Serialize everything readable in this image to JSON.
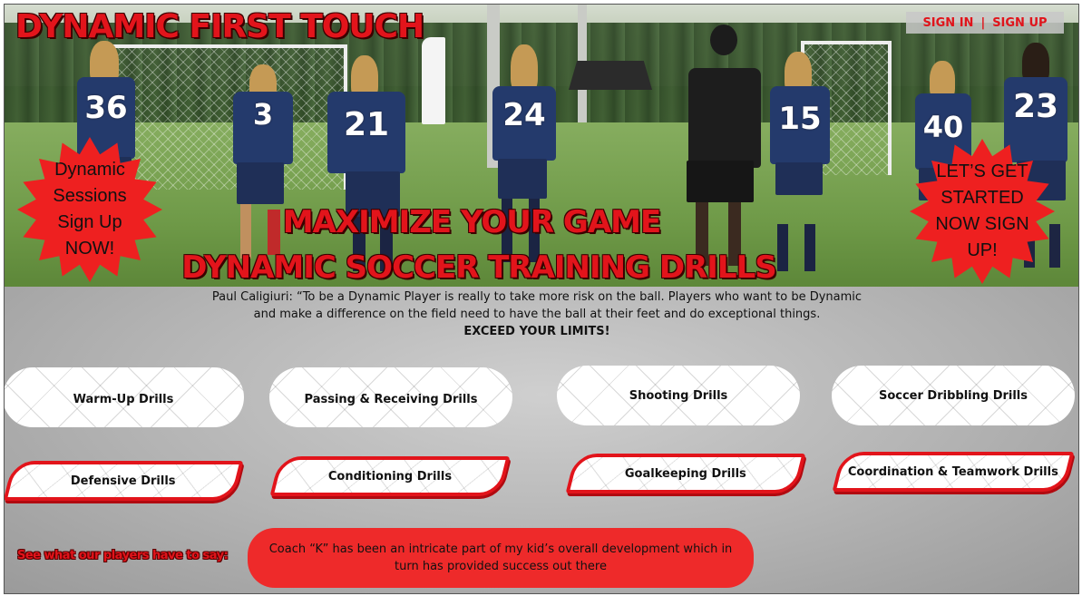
{
  "header": {
    "site_title": "DYNAMIC FIRST TOUCH",
    "sign_in": "SIGN IN",
    "separator": "|",
    "sign_up": "SIGN UP"
  },
  "hero": {
    "left_burst": "Dynamic Sessions Sign Up NOW!",
    "right_burst": "LET’S GET STARTED NOW SIGN UP!",
    "headline_line1": "MAXIMIZE YOUR GAME",
    "headline_line2": "DYNAMIC SOCCER TRAINING DRILLS",
    "jersey_numbers": [
      "36",
      "3",
      "21",
      "24",
      "15",
      "40",
      "23"
    ]
  },
  "quote": {
    "line1": "Paul Caligiuri: “To be a Dynamic Player is really to take more risk on the ball. Players who want to be Dynamic",
    "line2": "and make a difference on the field need to have the ball at their feet and do exceptional things.",
    "line3": "EXCEED YOUR LIMITS!"
  },
  "drills_row1": [
    {
      "label": "Warm-Up Drills"
    },
    {
      "label": "Passing & Receiving Drills"
    },
    {
      "label": "Shooting Drills"
    },
    {
      "label": "Soccer Dribbling Drills"
    }
  ],
  "drills_row2": [
    {
      "label": "Defensive Drills"
    },
    {
      "label": "Conditioning Drills"
    },
    {
      "label": "Goalkeeping Drills"
    },
    {
      "label": "Coordination & Teamwork Drills"
    }
  ],
  "testimonial": {
    "label": "See what our players have to say:",
    "text": "Coach “K” has been an intricate part of my kid’s overall development which in turn has provided success out there"
  },
  "colors": {
    "brand_red": "#e2141b",
    "panel_gray": "#b3b3b3",
    "jersey_navy": "#243a6c"
  }
}
